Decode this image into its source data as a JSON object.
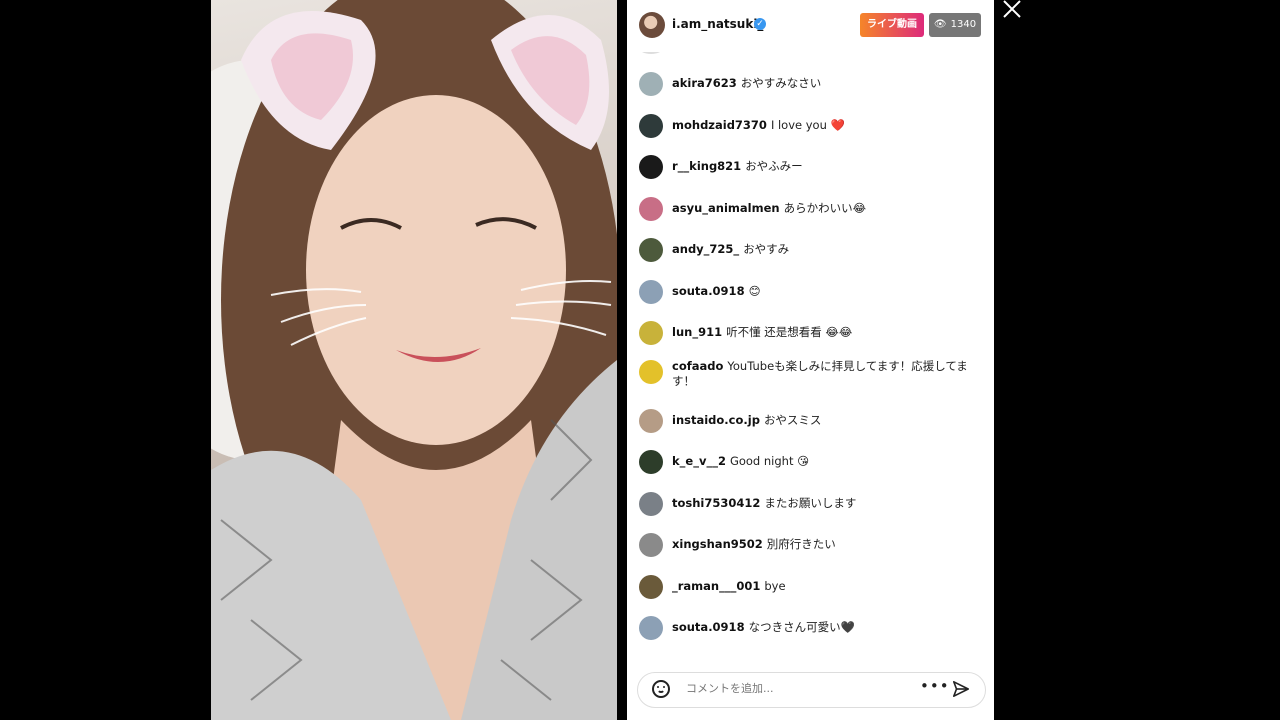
{
  "stream": {
    "username": "i.am_natsuki_",
    "live_label": "ライブ動画",
    "viewer_count": "1340"
  },
  "comments": [
    {
      "user": "akira7623",
      "text": "おやすみなさい",
      "avatar_color": "#9fb0b5"
    },
    {
      "user": "mohdzaid7370",
      "text": "I love you ❤️",
      "avatar_color": "#2e3a3a"
    },
    {
      "user": "r__king821",
      "text": "おやふみー",
      "avatar_color": "#1a1a1a"
    },
    {
      "user": "asyu_animalmen",
      "text": "あらかわいい😂",
      "avatar_color": "#c86e86"
    },
    {
      "user": "andy_725_",
      "text": "おやすみ",
      "avatar_color": "#4d5a3c"
    },
    {
      "user": "souta.0918",
      "text": "😊",
      "avatar_color": "#8ca0b5"
    },
    {
      "user": "lun_911",
      "text": "听不懂 还是想看看 😂😂",
      "avatar_color": "#c8b23a"
    },
    {
      "user": "cofaado",
      "text": "YouTubeも楽しみに拝見してます！応援してます！",
      "avatar_color": "#e3c12a"
    },
    {
      "user": "instaido.co.jp",
      "text": "おやスミス",
      "avatar_color": "#b59c86"
    },
    {
      "user": "k_e_v__2",
      "text": "Good night 😘",
      "avatar_color": "#2d3d2a"
    },
    {
      "user": "toshi7530412",
      "text": "またお願いします",
      "avatar_color": "#7a8087"
    },
    {
      "user": "xingshan9502",
      "text": "別府行きたい",
      "avatar_color": "#8a8a8a"
    },
    {
      "user": "_raman___001",
      "text": "bye",
      "avatar_color": "#6a5a3a"
    },
    {
      "user": "souta.0918",
      "text": "なつきさん可愛い🖤",
      "avatar_color": "#8ca0b5"
    }
  ],
  "input": {
    "placeholder": "コメントを追加..."
  },
  "icons": {
    "close": "close-icon",
    "emoji": "smile-icon",
    "more": "more-icon",
    "send": "send-icon",
    "eye": "eye-icon",
    "verified": "verified-icon"
  },
  "colors": {
    "live_gradient_start": "#f58529",
    "live_gradient_end": "#dd2a7b",
    "verified": "#3897f0",
    "viewer_badge": "#777777"
  }
}
